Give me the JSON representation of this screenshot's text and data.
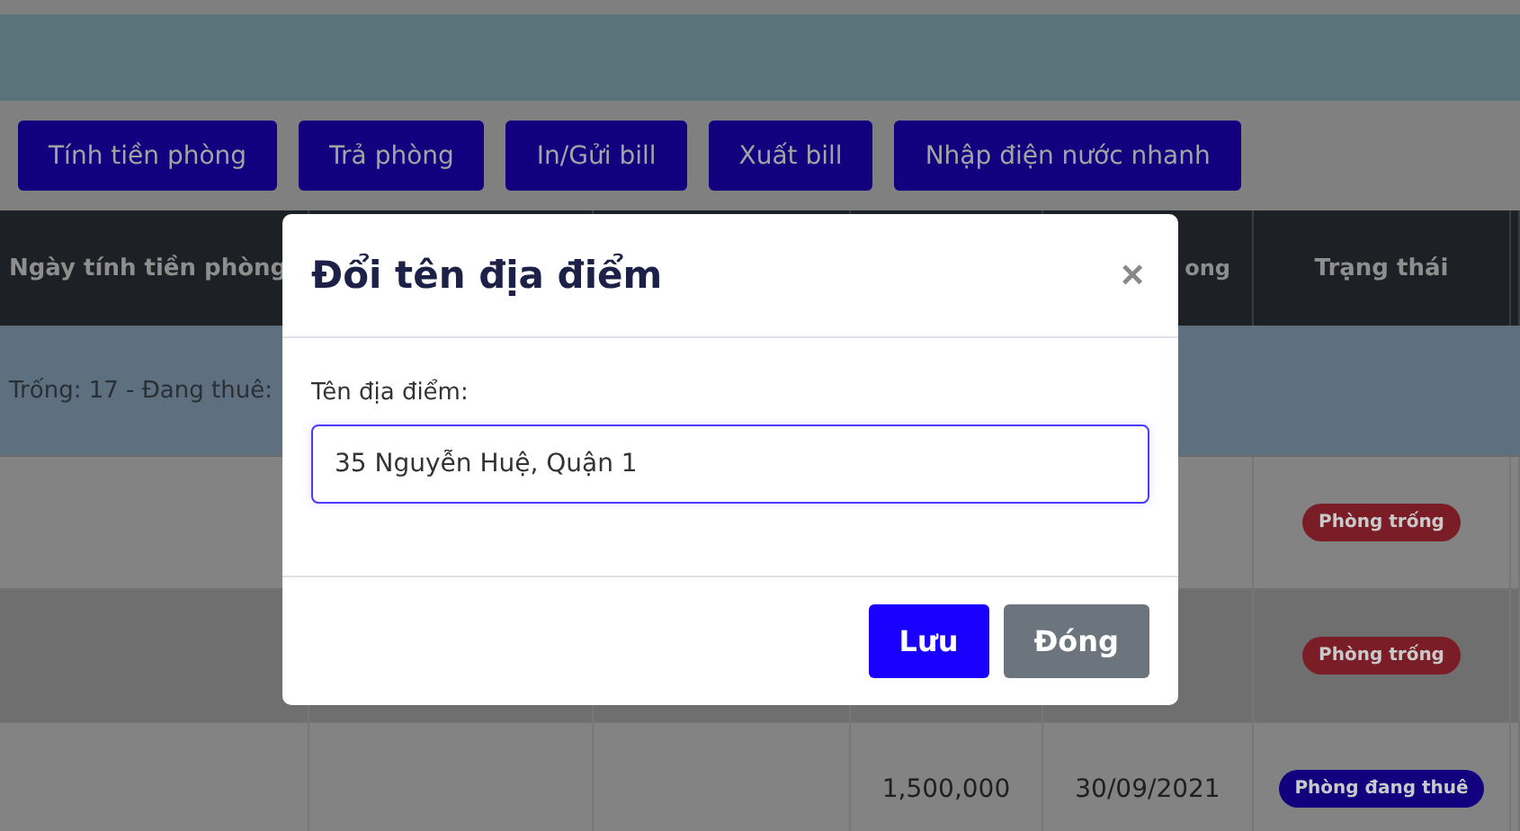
{
  "toolbar": {
    "buttons": [
      "Tính tiền phòng",
      "Trả phòng",
      "In/Gửi bill",
      "Xuất bill",
      "Nhập điện nước nhanh"
    ]
  },
  "table": {
    "columns": [
      {
        "label": "Ngày tính tiền phòng"
      },
      {},
      {},
      {},
      {
        "label": "ong"
      },
      {
        "label": "Trạng thái"
      }
    ],
    "summary": "Trống: 17 - Đang thuê:",
    "rows": [
      {
        "status": "Phòng trống",
        "color": "#7a1d27"
      },
      {
        "status": "Phòng trống",
        "color": "#7a1d27"
      },
      {
        "amount": "1,500,000",
        "date": "30/09/2021",
        "status": "Phòng đang thuê",
        "color": "#12007f"
      }
    ]
  },
  "dialog": {
    "title": "Đổi tên địa điểm",
    "close": "×",
    "field_label": "Tên địa điểm:",
    "field_value": "35 Nguyễn Huệ, Quận 1",
    "buttons": [
      {
        "label": "Lưu",
        "kind": "primary"
      },
      {
        "label": "Đóng",
        "kind": "secondary"
      }
    ]
  }
}
